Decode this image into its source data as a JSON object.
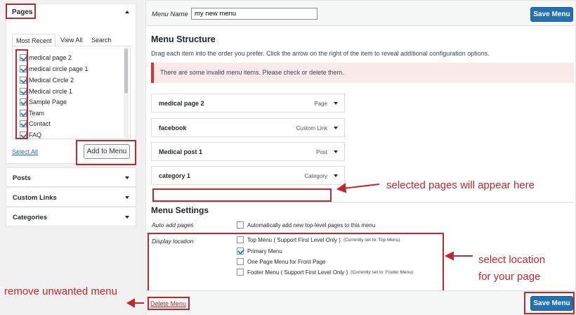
{
  "left": {
    "pages_title": "Pages",
    "tabs": [
      "Most Recent",
      "View All",
      "Search"
    ],
    "pages": [
      {
        "label": "medical page 2",
        "checked": true
      },
      {
        "label": "medical circle page 1",
        "checked": true
      },
      {
        "label": "Medical Circle 2",
        "checked": true
      },
      {
        "label": "Medical circle 1",
        "checked": true
      },
      {
        "label": "Sample Page",
        "checked": true
      },
      {
        "label": "Team",
        "checked": true
      },
      {
        "label": "Contact",
        "checked": true
      },
      {
        "label": "FAQ",
        "checked": true
      }
    ],
    "select_all": "Select All",
    "add_to_menu": "Add to Menu",
    "sections": [
      "Posts",
      "Custom Links",
      "Categories"
    ]
  },
  "header": {
    "menu_name_label": "Menu Name",
    "menu_name_value": "my new menu",
    "save_label": "Save Menu"
  },
  "structure": {
    "title": "Menu Structure",
    "instructions": "Drag each item into the order you prefer. Click the arrow on the right of the item to reveal additional configuration options.",
    "error": "There are some invalid menu items. Please check or delete them.",
    "items": [
      {
        "title": "medical page 2",
        "type": "Page"
      },
      {
        "title": "facebook",
        "type": "Custom Link"
      },
      {
        "title": "Medical post 1",
        "type": "Post"
      },
      {
        "title": "category 1",
        "type": "Category"
      }
    ]
  },
  "settings": {
    "title": "Menu Settings",
    "auto_add_label": "Auto add pages",
    "auto_add_option": "Automatically add new top-level pages to this menu",
    "display_location_label": "Display location",
    "locations": [
      {
        "label": "Top Menu ( Support First Level Only )",
        "note": "(Currently set to: Top Menu)",
        "checked": false
      },
      {
        "label": "Primary Menu",
        "note": "",
        "checked": true
      },
      {
        "label": "One Page Menu for Front Page",
        "note": "",
        "checked": false
      },
      {
        "label": "Footer Menu ( Support First Level Only )",
        "note": "(Currently set to: Footer Menu)",
        "checked": false
      }
    ]
  },
  "footer": {
    "delete_menu": "Delete Menu",
    "save_label": "Save Menu"
  },
  "annotations": {
    "selected_pages": "selected pages will appear here",
    "select_location_1": "select location",
    "select_location_2": "for your page",
    "remove_menu": "remove unwanted menu"
  },
  "colors": {
    "annotation_red": "#c1272d",
    "primary_blue": "#2271b1",
    "error_bg": "#fbeaea"
  }
}
